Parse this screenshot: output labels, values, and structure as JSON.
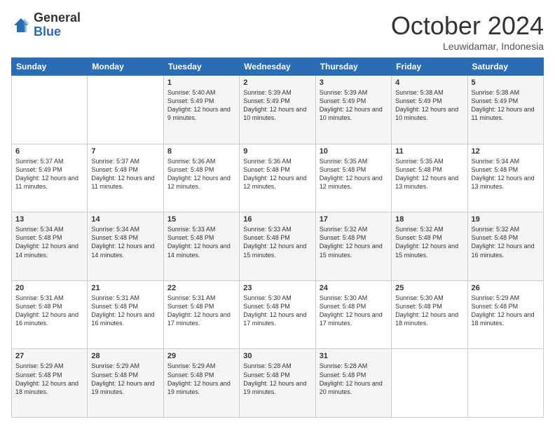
{
  "logo": {
    "general": "General",
    "blue": "Blue"
  },
  "header": {
    "month": "October 2024",
    "location": "Leuwidamar, Indonesia"
  },
  "weekdays": [
    "Sunday",
    "Monday",
    "Tuesday",
    "Wednesday",
    "Thursday",
    "Friday",
    "Saturday"
  ],
  "weeks": [
    [
      {
        "day": "",
        "sunrise": "",
        "sunset": "",
        "daylight": ""
      },
      {
        "day": "",
        "sunrise": "",
        "sunset": "",
        "daylight": ""
      },
      {
        "day": "1",
        "sunrise": "Sunrise: 5:40 AM",
        "sunset": "Sunset: 5:49 PM",
        "daylight": "Daylight: 12 hours and 9 minutes."
      },
      {
        "day": "2",
        "sunrise": "Sunrise: 5:39 AM",
        "sunset": "Sunset: 5:49 PM",
        "daylight": "Daylight: 12 hours and 10 minutes."
      },
      {
        "day": "3",
        "sunrise": "Sunrise: 5:39 AM",
        "sunset": "Sunset: 5:49 PM",
        "daylight": "Daylight: 12 hours and 10 minutes."
      },
      {
        "day": "4",
        "sunrise": "Sunrise: 5:38 AM",
        "sunset": "Sunset: 5:49 PM",
        "daylight": "Daylight: 12 hours and 10 minutes."
      },
      {
        "day": "5",
        "sunrise": "Sunrise: 5:38 AM",
        "sunset": "Sunset: 5:49 PM",
        "daylight": "Daylight: 12 hours and 11 minutes."
      }
    ],
    [
      {
        "day": "6",
        "sunrise": "Sunrise: 5:37 AM",
        "sunset": "Sunset: 5:49 PM",
        "daylight": "Daylight: 12 hours and 11 minutes."
      },
      {
        "day": "7",
        "sunrise": "Sunrise: 5:37 AM",
        "sunset": "Sunset: 5:48 PM",
        "daylight": "Daylight: 12 hours and 11 minutes."
      },
      {
        "day": "8",
        "sunrise": "Sunrise: 5:36 AM",
        "sunset": "Sunset: 5:48 PM",
        "daylight": "Daylight: 12 hours and 12 minutes."
      },
      {
        "day": "9",
        "sunrise": "Sunrise: 5:36 AM",
        "sunset": "Sunset: 5:48 PM",
        "daylight": "Daylight: 12 hours and 12 minutes."
      },
      {
        "day": "10",
        "sunrise": "Sunrise: 5:35 AM",
        "sunset": "Sunset: 5:48 PM",
        "daylight": "Daylight: 12 hours and 12 minutes."
      },
      {
        "day": "11",
        "sunrise": "Sunrise: 5:35 AM",
        "sunset": "Sunset: 5:48 PM",
        "daylight": "Daylight: 12 hours and 13 minutes."
      },
      {
        "day": "12",
        "sunrise": "Sunrise: 5:34 AM",
        "sunset": "Sunset: 5:48 PM",
        "daylight": "Daylight: 12 hours and 13 minutes."
      }
    ],
    [
      {
        "day": "13",
        "sunrise": "Sunrise: 5:34 AM",
        "sunset": "Sunset: 5:48 PM",
        "daylight": "Daylight: 12 hours and 14 minutes."
      },
      {
        "day": "14",
        "sunrise": "Sunrise: 5:34 AM",
        "sunset": "Sunset: 5:48 PM",
        "daylight": "Daylight: 12 hours and 14 minutes."
      },
      {
        "day": "15",
        "sunrise": "Sunrise: 5:33 AM",
        "sunset": "Sunset: 5:48 PM",
        "daylight": "Daylight: 12 hours and 14 minutes."
      },
      {
        "day": "16",
        "sunrise": "Sunrise: 5:33 AM",
        "sunset": "Sunset: 5:48 PM",
        "daylight": "Daylight: 12 hours and 15 minutes."
      },
      {
        "day": "17",
        "sunrise": "Sunrise: 5:32 AM",
        "sunset": "Sunset: 5:48 PM",
        "daylight": "Daylight: 12 hours and 15 minutes."
      },
      {
        "day": "18",
        "sunrise": "Sunrise: 5:32 AM",
        "sunset": "Sunset: 5:48 PM",
        "daylight": "Daylight: 12 hours and 15 minutes."
      },
      {
        "day": "19",
        "sunrise": "Sunrise: 5:32 AM",
        "sunset": "Sunset: 5:48 PM",
        "daylight": "Daylight: 12 hours and 16 minutes."
      }
    ],
    [
      {
        "day": "20",
        "sunrise": "Sunrise: 5:31 AM",
        "sunset": "Sunset: 5:48 PM",
        "daylight": "Daylight: 12 hours and 16 minutes."
      },
      {
        "day": "21",
        "sunrise": "Sunrise: 5:31 AM",
        "sunset": "Sunset: 5:48 PM",
        "daylight": "Daylight: 12 hours and 16 minutes."
      },
      {
        "day": "22",
        "sunrise": "Sunrise: 5:31 AM",
        "sunset": "Sunset: 5:48 PM",
        "daylight": "Daylight: 12 hours and 17 minutes."
      },
      {
        "day": "23",
        "sunrise": "Sunrise: 5:30 AM",
        "sunset": "Sunset: 5:48 PM",
        "daylight": "Daylight: 12 hours and 17 minutes."
      },
      {
        "day": "24",
        "sunrise": "Sunrise: 5:30 AM",
        "sunset": "Sunset: 5:48 PM",
        "daylight": "Daylight: 12 hours and 17 minutes."
      },
      {
        "day": "25",
        "sunrise": "Sunrise: 5:30 AM",
        "sunset": "Sunset: 5:48 PM",
        "daylight": "Daylight: 12 hours and 18 minutes."
      },
      {
        "day": "26",
        "sunrise": "Sunrise: 5:29 AM",
        "sunset": "Sunset: 5:48 PM",
        "daylight": "Daylight: 12 hours and 18 minutes."
      }
    ],
    [
      {
        "day": "27",
        "sunrise": "Sunrise: 5:29 AM",
        "sunset": "Sunset: 5:48 PM",
        "daylight": "Daylight: 12 hours and 18 minutes."
      },
      {
        "day": "28",
        "sunrise": "Sunrise: 5:29 AM",
        "sunset": "Sunset: 5:48 PM",
        "daylight": "Daylight: 12 hours and 19 minutes."
      },
      {
        "day": "29",
        "sunrise": "Sunrise: 5:29 AM",
        "sunset": "Sunset: 5:48 PM",
        "daylight": "Daylight: 12 hours and 19 minutes."
      },
      {
        "day": "30",
        "sunrise": "Sunrise: 5:28 AM",
        "sunset": "Sunset: 5:48 PM",
        "daylight": "Daylight: 12 hours and 19 minutes."
      },
      {
        "day": "31",
        "sunrise": "Sunrise: 5:28 AM",
        "sunset": "Sunset: 5:48 PM",
        "daylight": "Daylight: 12 hours and 20 minutes."
      },
      {
        "day": "",
        "sunrise": "",
        "sunset": "",
        "daylight": ""
      },
      {
        "day": "",
        "sunrise": "",
        "sunset": "",
        "daylight": ""
      }
    ]
  ]
}
